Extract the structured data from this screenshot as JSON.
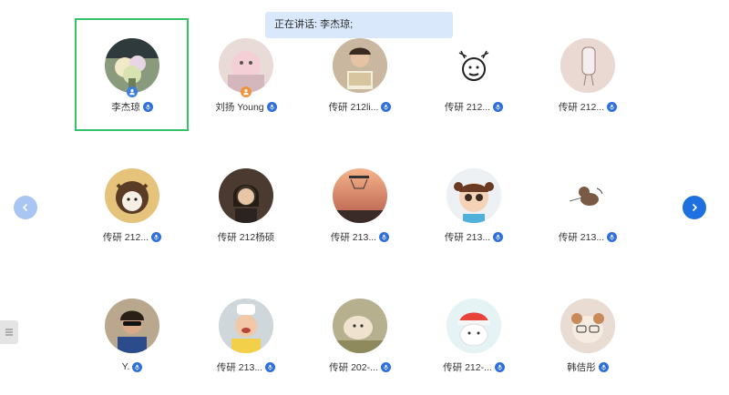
{
  "banner": {
    "text": "正在讲话: 李杰琼;"
  },
  "participants": [
    {
      "name": "李杰琼",
      "role_badge": "user-icon",
      "badge_color": "#3a7ee0",
      "avatar": "bouquet-photo"
    },
    {
      "name": "刘扬 Young",
      "role_badge": "user-icon",
      "badge_color": "#f0923a",
      "avatar": "pink-toy-photo"
    },
    {
      "name": "传研 212li...",
      "avatar": "girl-book-photo"
    },
    {
      "name": "传研 212...",
      "avatar": "cartoon-face-drawing"
    },
    {
      "name": "传研 212...",
      "avatar": "sketch-figure-drawing"
    },
    {
      "name": "传研 212...",
      "avatar": "cartoon-dog-drawing"
    },
    {
      "name": "传研 212杨硕",
      "avatar": "portrait-photo"
    },
    {
      "name": "传研 213...",
      "avatar": "basketball-sunset-photo"
    },
    {
      "name": "传研 213...",
      "avatar": "cartoon-girl-3d"
    },
    {
      "name": "传研 213...",
      "avatar": "puppy-doodle"
    },
    {
      "name": "Y.",
      "avatar": "sunglasses-kid-photo"
    },
    {
      "name": "传研 213...",
      "avatar": "chef-baby-photo"
    },
    {
      "name": "传研 202-...",
      "avatar": "plush-toy-photo"
    },
    {
      "name": "传研 212-...",
      "avatar": "cartoon-hat-character"
    },
    {
      "name": "韩佶彤",
      "avatar": "dog-glasses-photo"
    }
  ],
  "controls": {
    "prev": "chevron-left-icon",
    "next": "chevron-right-icon",
    "list": "list-icon"
  },
  "colors": {
    "accent": "#1e6fe0",
    "highlight": "#34c26a",
    "banner_bg": "#d9e8fb"
  }
}
